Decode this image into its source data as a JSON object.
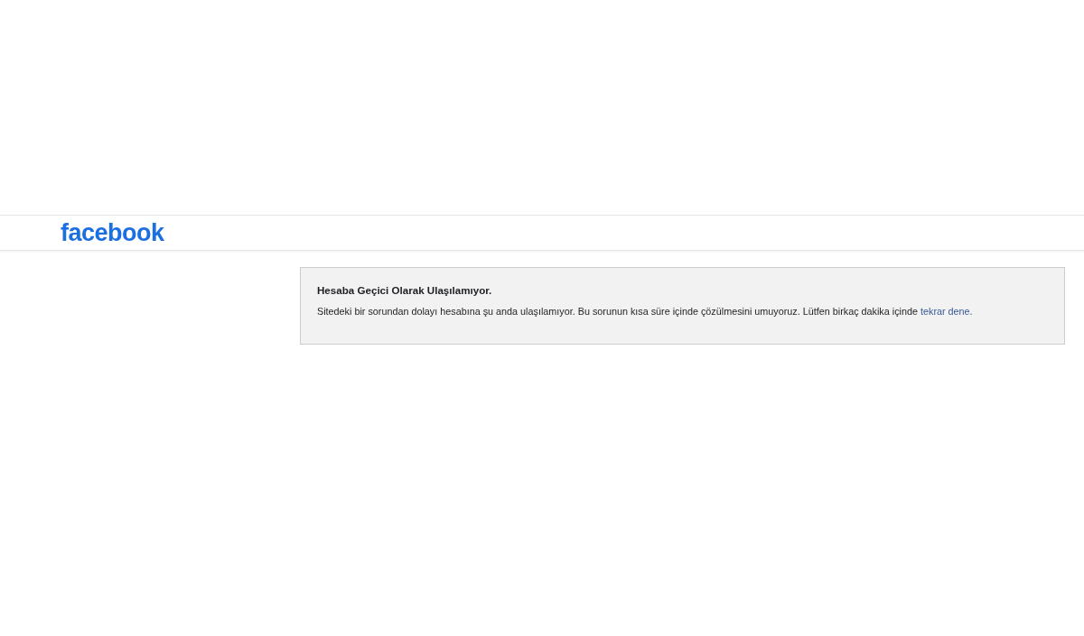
{
  "header": {
    "logo": "facebook"
  },
  "message": {
    "title": "Hesaba Geçici Olarak Ulaşılamıyor.",
    "text": "Sitedeki bir sorundan dolayı hesabına şu anda ulaşılamıyor. Bu sorunun kısa süre içinde çözülmesini umuyoruz. Lütfen birkaç dakika içinde ",
    "link": "tekrar dene."
  }
}
